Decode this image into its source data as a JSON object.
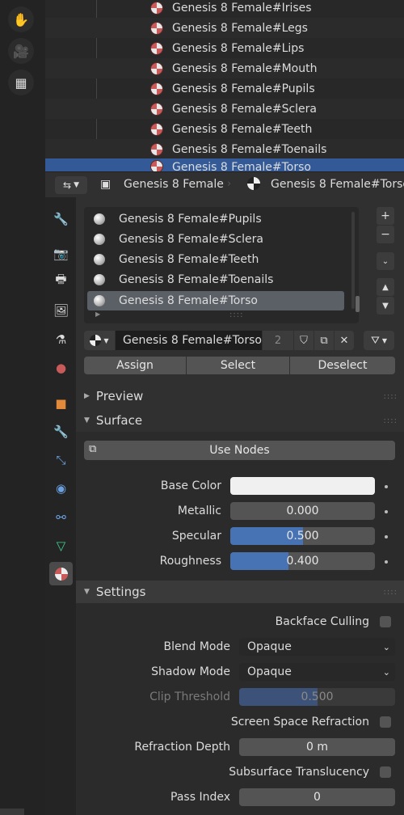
{
  "outliner": {
    "items": [
      {
        "label": "Genesis 8 Female#Irises"
      },
      {
        "label": "Genesis 8 Female#Legs"
      },
      {
        "label": "Genesis 8 Female#Lips"
      },
      {
        "label": "Genesis 8 Female#Mouth"
      },
      {
        "label": "Genesis 8 Female#Pupils"
      },
      {
        "label": "Genesis 8 Female#Sclera"
      },
      {
        "label": "Genesis 8 Female#Teeth"
      },
      {
        "label": "Genesis 8 Female#Toenails"
      },
      {
        "label": "Genesis 8 Female#Torso"
      }
    ]
  },
  "header": {
    "object_name": "Genesis 8 Female",
    "material_name": "Genesis 8 Female#Torso"
  },
  "slots": {
    "items": [
      {
        "label": "Genesis 8 Female#Pupils"
      },
      {
        "label": "Genesis 8 Female#Sclera"
      },
      {
        "label": "Genesis 8 Female#Teeth"
      },
      {
        "label": "Genesis 8 Female#Toenails"
      },
      {
        "label": "Genesis 8 Female#Torso"
      }
    ],
    "selected_index": 4
  },
  "material_bar": {
    "name": "Genesis 8 Female#Torso",
    "users": "2"
  },
  "assign_row": {
    "assign": "Assign",
    "select": "Select",
    "deselect": "Deselect"
  },
  "sections": {
    "preview": "Preview",
    "surface": "Surface",
    "settings": "Settings"
  },
  "surface": {
    "use_nodes": "Use Nodes",
    "base_color_label": "Base Color",
    "base_color": "#f0f0f0",
    "metallic_label": "Metallic",
    "metallic": "0.000",
    "metallic_fraction": 0,
    "specular_label": "Specular",
    "specular": "0.500",
    "specular_fraction": 0.5,
    "roughness_label": "Roughness",
    "roughness": "0.400",
    "roughness_fraction": 0.4
  },
  "settings": {
    "backface_culling": "Backface Culling",
    "blend_mode_label": "Blend Mode",
    "blend_mode": "Opaque",
    "shadow_mode_label": "Shadow Mode",
    "shadow_mode": "Opaque",
    "clip_threshold_label": "Clip Threshold",
    "clip_threshold": "0.500",
    "clip_fraction": 0.5,
    "ssr": "Screen Space Refraction",
    "refraction_depth_label": "Refraction Depth",
    "refraction_depth": "0 m",
    "subsurface": "Subsurface Translucency",
    "pass_index_label": "Pass Index",
    "pass_index": "0"
  },
  "colors": {
    "accent": "#335a96",
    "slider": "#4772b3"
  }
}
